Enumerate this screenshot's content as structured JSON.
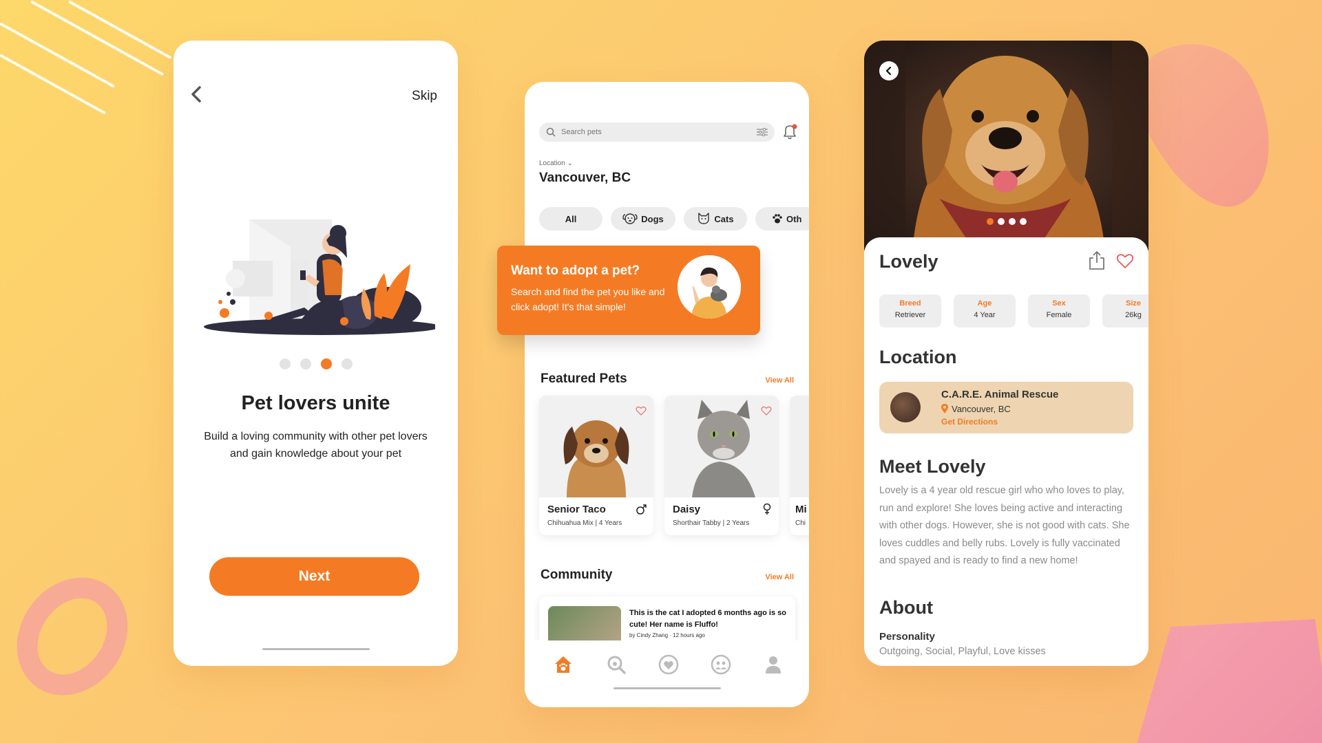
{
  "colors": {
    "accent": "#f47b24",
    "background": "#fcc374",
    "chip_bg": "#ececec",
    "shelter_bg": "#eed4b0"
  },
  "onboarding": {
    "back_icon": "chevron-left-icon",
    "skip_label": "Skip",
    "illustration": "woman-sitting-with-phone-illustration",
    "pager_active_step": 3,
    "pager_total_steps": 4,
    "title": "Pet lovers unite",
    "description": "Build a loving community with other pet lovers and gain knowledge about your pet",
    "next_label": "Next"
  },
  "home": {
    "search": {
      "placeholder": "Search pets",
      "icon": "search-icon",
      "filter_icon": "sliders-icon"
    },
    "notification_icon": "bell-icon",
    "location_label": "Location",
    "location_city": "Vancouver, BC",
    "categories": [
      {
        "label": "All",
        "icon": ""
      },
      {
        "label": "Dogs",
        "icon": "dog-icon"
      },
      {
        "label": "Cats",
        "icon": "cat-icon"
      },
      {
        "label": "Oth",
        "icon": "paw-icon"
      }
    ],
    "banner": {
      "title": "Want to adopt a pet?",
      "text": "Search and find the pet you like and click adopt! It's that simple!"
    },
    "featured_title": "Featured Pets",
    "featured_view_all": "View All",
    "featured_pets": [
      {
        "name": "Senior Taco",
        "details": "Chihuahua Mix | 4 Years",
        "sex_icon": "male-icon"
      },
      {
        "name": "Daisy",
        "details": "Shorthair Tabby | 2 Years",
        "sex_icon": "female-icon"
      },
      {
        "name": "Mi",
        "details": "Chi",
        "sex_icon": ""
      }
    ],
    "community_title": "Community",
    "community_view_all": "View All",
    "post": {
      "text": "This is the cat I adopted 6 months ago is so cute! Her name is Fluffo!",
      "meta": "by Cindy Zhang · 12 hours ago"
    },
    "tabs": [
      "home-icon",
      "search-icon",
      "heart-icon",
      "community-icon",
      "profile-icon"
    ],
    "active_tab": "home-icon"
  },
  "detail": {
    "photo_active_index": 1,
    "photo_count": 4,
    "name": "Lovely",
    "attributes": [
      {
        "key": "Breed",
        "value": "Retriever"
      },
      {
        "key": "Age",
        "value": "4 Year"
      },
      {
        "key": "Sex",
        "value": "Female"
      },
      {
        "key": "Size",
        "value": "26kg"
      }
    ],
    "location_title": "Location",
    "shelter": {
      "name": "C.A.R.E. Animal Rescue",
      "city": "Vancouver, BC",
      "directions": "Get Directions"
    },
    "meet_title": "Meet Lovely",
    "meet_text": "Lovely is a 4 year old rescue girl who who loves to play, run and explore! She loves being active and interacting with other dogs. However, she is not good with cats. She loves cuddles and belly rubs. Lovely is fully vaccinated and spayed and is ready to find a new home!",
    "about_title": "About",
    "personality_label": "Personality",
    "personality_value": "Outgoing, Social, Playful, Love kisses"
  }
}
